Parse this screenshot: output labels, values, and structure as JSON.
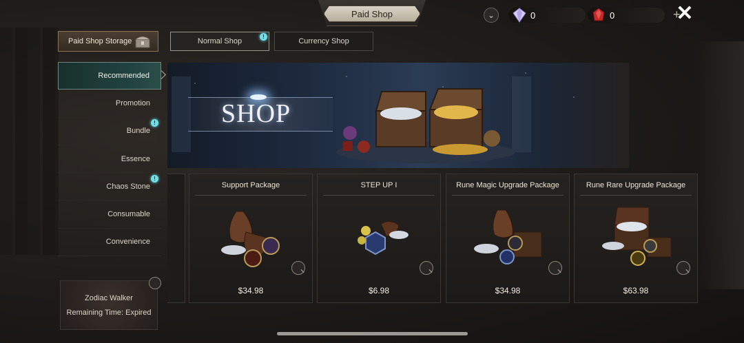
{
  "header": {
    "title": "Paid Shop",
    "currencies": [
      {
        "icon": "diamond-gem-icon",
        "value": "0",
        "color": "#b9a6e8"
      },
      {
        "icon": "red-gem-icon",
        "value": "0",
        "color": "#c42a2a"
      }
    ]
  },
  "top_tabs": {
    "storage": "Paid Shop Storage",
    "normal": "Normal Shop",
    "currency": "Currency Shop",
    "normal_badge": "!"
  },
  "sidebar": {
    "items": [
      {
        "label": "Recommended",
        "active": true
      },
      {
        "label": "Promotion"
      },
      {
        "label": "Bundle",
        "badge": "!"
      },
      {
        "label": "Essence"
      },
      {
        "label": "Chaos Stone",
        "badge": "!"
      },
      {
        "label": "Consumable"
      },
      {
        "label": "Convenience"
      }
    ]
  },
  "buff": {
    "name": "Zodiac Walker",
    "remaining": "Remaining Time: Expired"
  },
  "banner": {
    "text": "SHOP"
  },
  "products": [
    {
      "name": "Support Package",
      "price": "$34.98",
      "art": "sacks-gems"
    },
    {
      "name": "STEP UP I",
      "price": "$6.98",
      "art": "rune-stones"
    },
    {
      "name": "Rune Magic Upgrade Package",
      "price": "$34.98",
      "art": "sack-chest"
    },
    {
      "name": "Rune Rare Upgrade Package",
      "price": "$63.98",
      "art": "open-chest"
    }
  ],
  "accent": {
    "active_tab": "#214340",
    "badge": "#6fe0e8"
  }
}
